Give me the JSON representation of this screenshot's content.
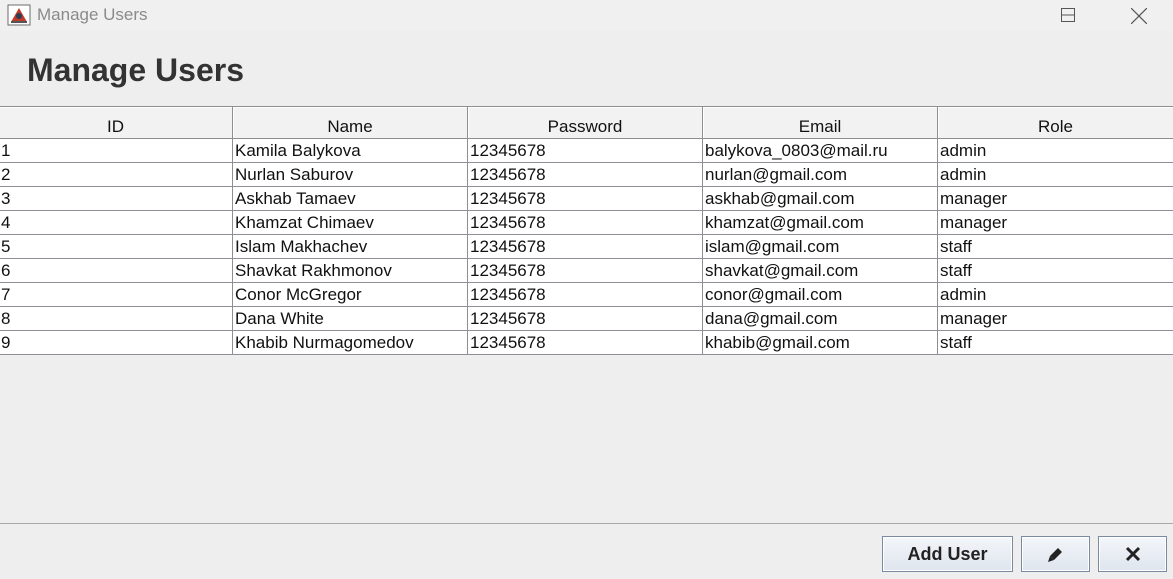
{
  "window": {
    "title": "Manage Users",
    "icon": "java-app-icon"
  },
  "page": {
    "title": "Manage Users"
  },
  "table": {
    "columns": [
      "ID",
      "Name",
      "Password",
      "Email",
      "Role"
    ],
    "rows": [
      [
        "1",
        "Kamila Balykova",
        "12345678",
        "balykova_0803@mail.ru",
        "admin"
      ],
      [
        "2",
        "Nurlan Saburov",
        "12345678",
        "nurlan@gmail.com",
        "admin"
      ],
      [
        "3",
        "Askhab Tamaev",
        "12345678",
        "askhab@gmail.com",
        "manager"
      ],
      [
        "4",
        "Khamzat Chimaev",
        "12345678",
        "khamzat@gmail.com",
        "manager"
      ],
      [
        "5",
        "Islam Makhachev",
        "12345678",
        "islam@gmail.com",
        "staff"
      ],
      [
        "6",
        "Shavkat Rakhmonov",
        "12345678",
        "shavkat@gmail.com",
        "staff"
      ],
      [
        "7",
        "Conor McGregor",
        "12345678",
        "conor@gmail.com",
        "admin"
      ],
      [
        "8",
        "Dana White",
        "12345678",
        "dana@gmail.com",
        "manager"
      ],
      [
        "9",
        "Khabib Nurmagomedov",
        "12345678",
        "khabib@gmail.com",
        "staff"
      ]
    ]
  },
  "actions": {
    "add_label": "Add User",
    "edit_icon": "pencil-icon",
    "delete_icon": "close-icon"
  }
}
